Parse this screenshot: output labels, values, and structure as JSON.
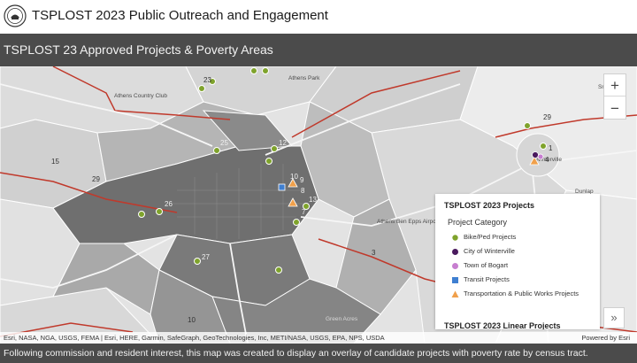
{
  "header": {
    "title": "TSPLOST 2023 Public Outreach and Engagement",
    "logo_icon": "county-seal-icon"
  },
  "panel": {
    "title": "TSPLOST 23 Approved Projects & Poverty Areas"
  },
  "map": {
    "place_labels": [
      "Athens Country Club",
      "Athens Park",
      "Athens Ben Epps Airport",
      "Winterville",
      "Dunlap",
      "Smithonia",
      "Green Acres"
    ],
    "highway_labels": [
      "29",
      "29",
      "15",
      "10"
    ],
    "project_numbers": [
      "23",
      "12",
      "25",
      "10",
      "9",
      "8",
      "13",
      "7",
      "26",
      "27",
      "1",
      "4",
      "3"
    ],
    "zoom_in_label": "+",
    "zoom_out_label": "−",
    "expand_label": "»"
  },
  "legend": {
    "title": "TSPLOST 2023 Projects",
    "subtitle": "Project Category",
    "items": [
      {
        "label": "Bike/Ped Projects",
        "shape": "circle",
        "color": "#7fa32c"
      },
      {
        "label": "City of Winterville",
        "shape": "circle",
        "color": "#4a1a5e"
      },
      {
        "label": "Town of Bogart",
        "shape": "circle",
        "color": "#c77fd0"
      },
      {
        "label": "Transit Projects",
        "shape": "square",
        "color": "#3f7fd1"
      },
      {
        "label": "Transportation & Public Works Projects",
        "shape": "triangle",
        "color": "#f0a04b"
      }
    ],
    "next_title": "TSPLOST 2023 Linear Projects"
  },
  "attribution": {
    "text": "Esri, NASA, NGA, USGS, FEMA | Esri, HERE, Garmin, SafeGraph, GeoTechnologies, Inc, METI/NASA, USGS, EPA, NPS, USDA",
    "powered": "Powered by Esri"
  },
  "caption": "Following commission and resident interest, this map was created to display an overlay of candidate projects with poverty rate by census tract."
}
